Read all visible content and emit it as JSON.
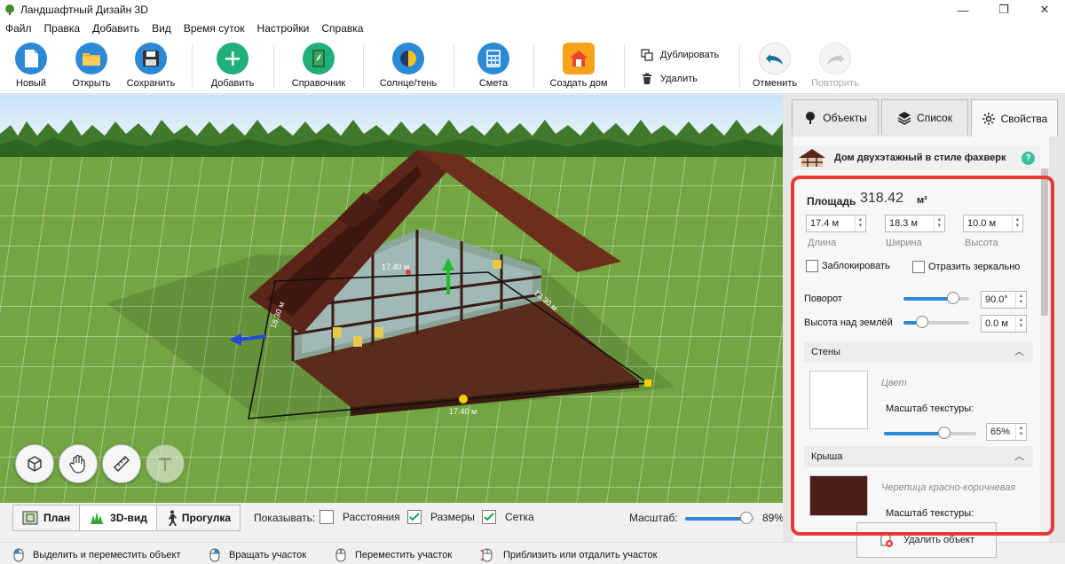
{
  "window": {
    "title": "Ландшафтный Дизайн 3D",
    "controls": [
      "—",
      "❐",
      "✕"
    ]
  },
  "menu": [
    "Файл",
    "Правка",
    "Добавить",
    "Вид",
    "Время суток",
    "Настройки",
    "Справка"
  ],
  "toolbar": {
    "new": "Новый",
    "open": "Открыть",
    "save": "Сохранить",
    "add": "Добавить",
    "reference": "Справочник",
    "sun_shade": "Солнце/тень",
    "estimate": "Смета",
    "create_house": "Создать дом",
    "duplicate": "Дублировать",
    "delete": "Удалить",
    "undo": "Отменить",
    "redo": "Повторить"
  },
  "viewport": {
    "dim_width": "17.40 м",
    "dim_depth": "18.30 м",
    "dim_depth2": "18.30 м",
    "dim_width_top": "17.40 м"
  },
  "view_tabs": [
    "План",
    "3D-вид",
    "Прогулка"
  ],
  "show": {
    "label": "Показывать:",
    "options": [
      {
        "label": "Расстояния",
        "checked": false
      },
      {
        "label": "Размеры",
        "checked": true
      },
      {
        "label": "Сетка",
        "checked": true
      }
    ]
  },
  "zoom": {
    "label": "Масштаб:",
    "value": 89,
    "text": "89%"
  },
  "status_hints": [
    "Выделить и переместить объект",
    "Вращать участок",
    "Переместить участок",
    "Приблизить или отдалить участок"
  ],
  "right_tabs": [
    "Объекты",
    "Список",
    "Свойства"
  ],
  "properties": {
    "object_name": "Дом двухэтажный в стиле фахверк",
    "help": "?",
    "area_label": "Площадь",
    "area_value": "318.42",
    "area_unit": "м²",
    "length": {
      "value": "17.4 м",
      "label": "Длина"
    },
    "width": {
      "value": "18.3 м",
      "label": "Ширина"
    },
    "height": {
      "value": "10.0 м",
      "label": "Высота"
    },
    "lock": "Заблокировать",
    "mirror": "Отразить зеркально",
    "rotation": {
      "label": "Поворот",
      "value": "90.0°",
      "level": 0.75
    },
    "elevation": {
      "label": "Высота над землёй",
      "value": "0.0 м",
      "level": 0.28
    },
    "walls": {
      "title": "Стены",
      "color_label": "Цвет",
      "scale_label": "Масштаб текстуры:",
      "scale_value": "65%",
      "level": 0.65,
      "color": "#ffffff"
    },
    "roof": {
      "title": "Крыша",
      "material": "Черепица красно-коричневая",
      "scale_label": "Масштаб текстуры:",
      "color": "#4a1d18"
    },
    "delete": "Удалить объект"
  },
  "colors": {
    "accent": "#2c89d6",
    "highlight": "#e53935",
    "house_wood": "#4e2418",
    "grass": "#7eb34a",
    "sky": "#d9ecf8"
  }
}
